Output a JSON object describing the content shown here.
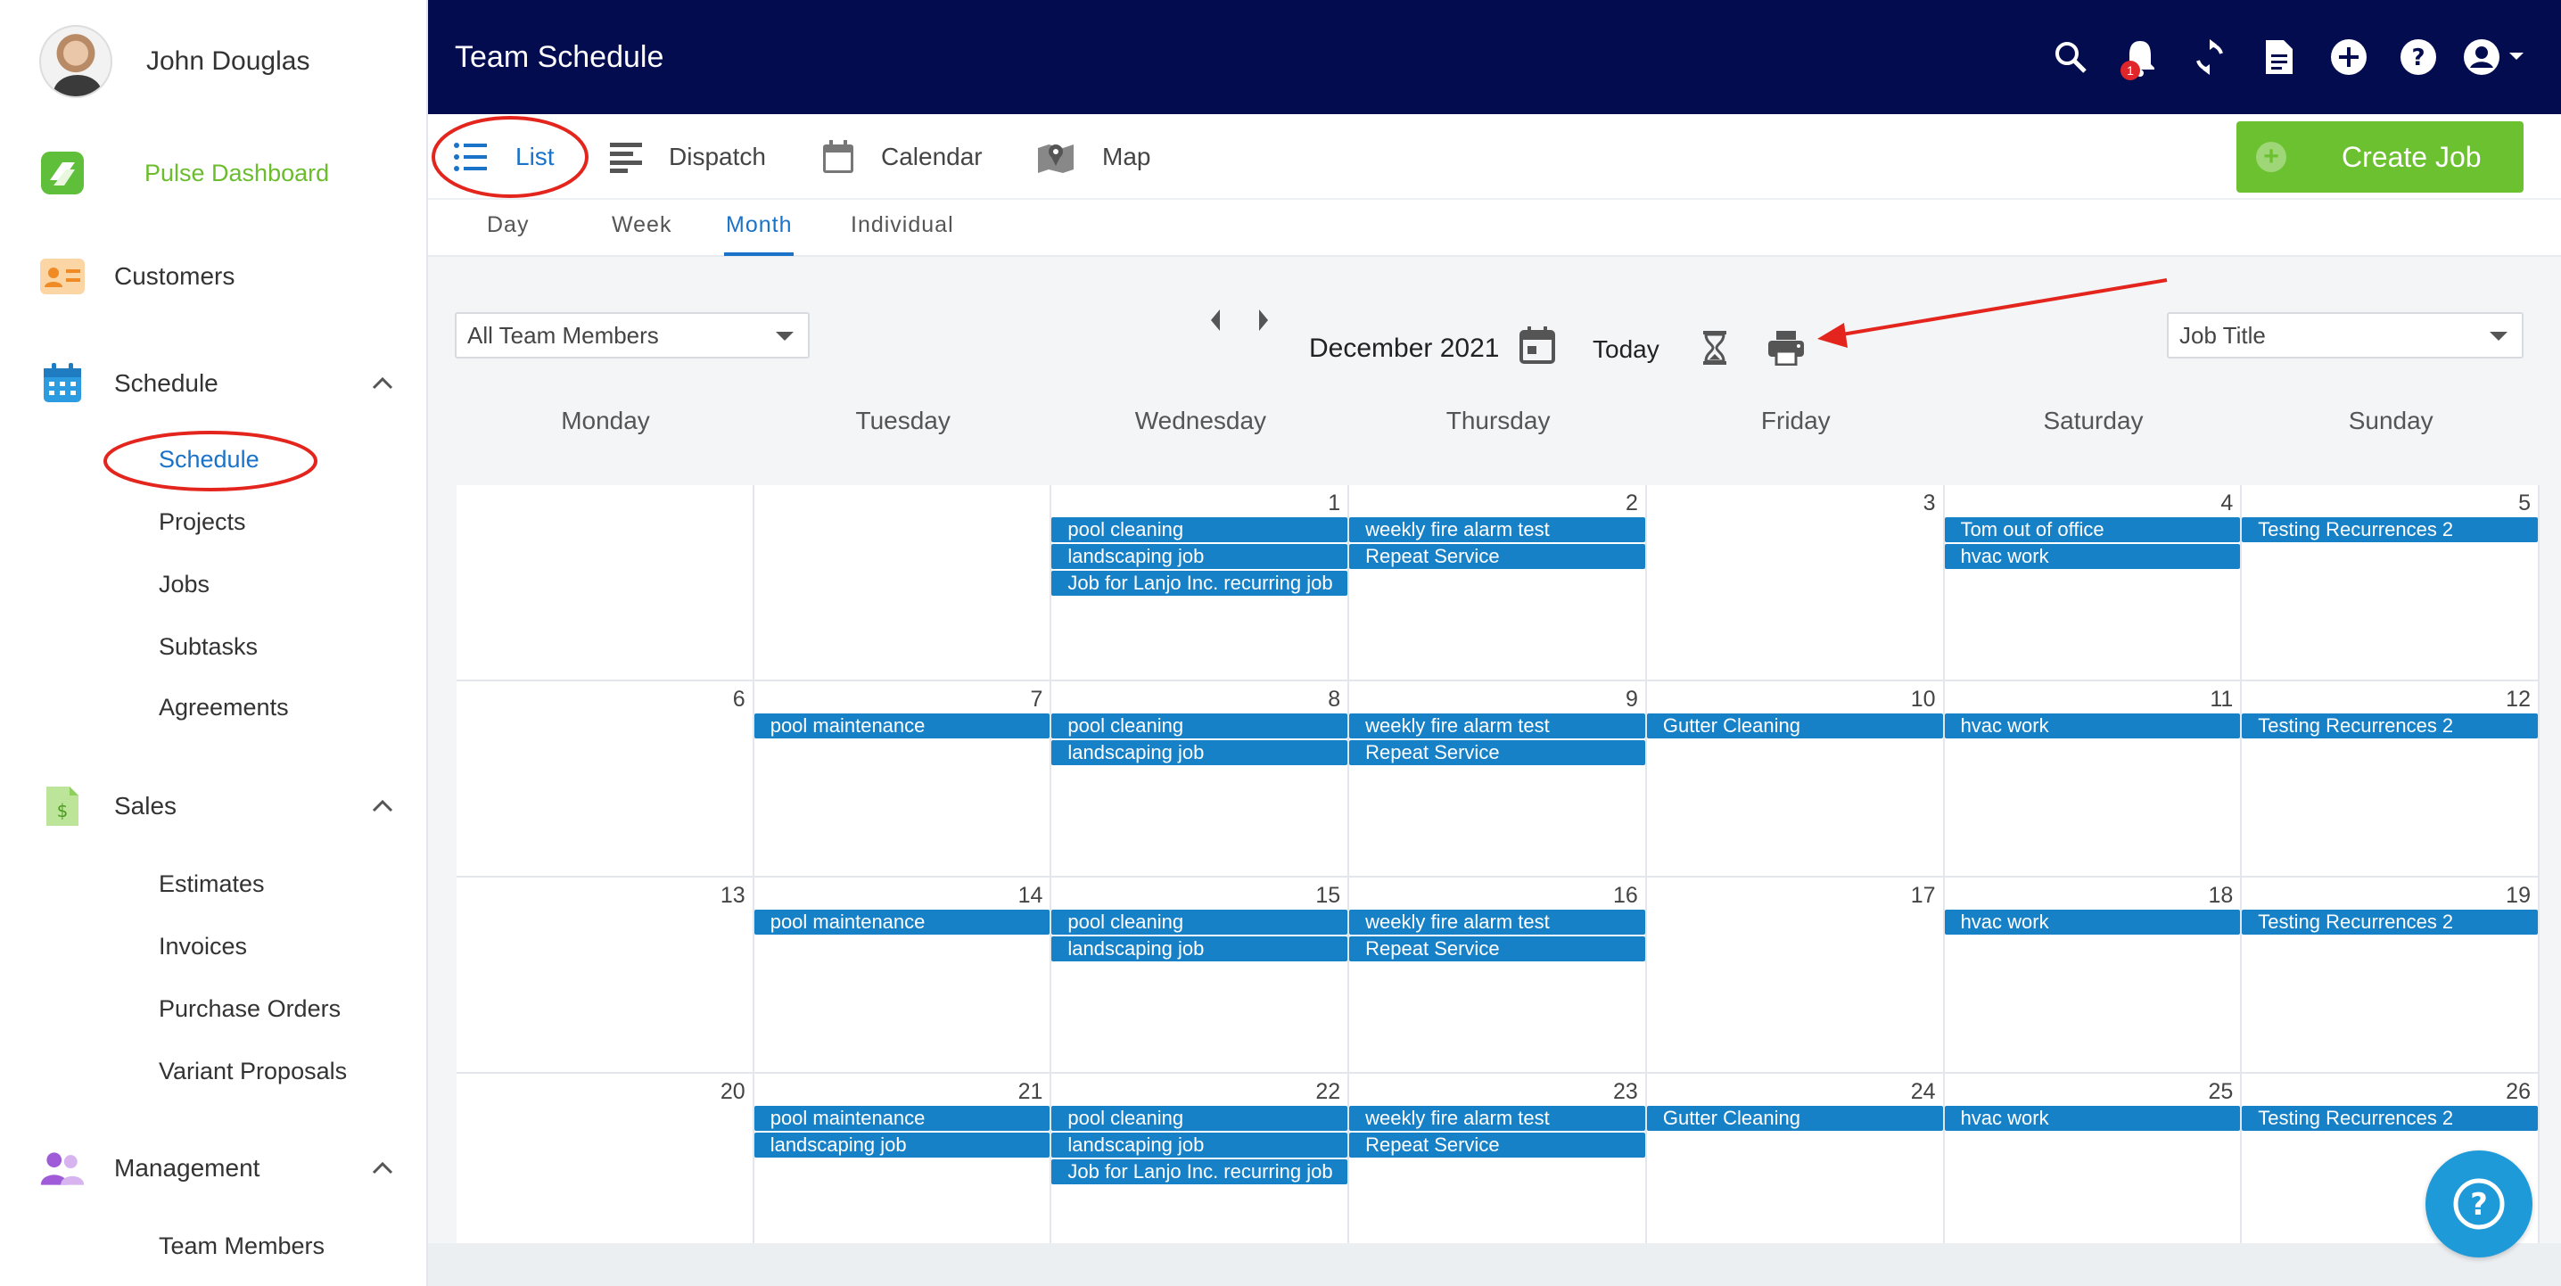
{
  "user": {
    "name": "John Douglas"
  },
  "sidebar": {
    "dashboard_label": "Pulse Dashboard",
    "customers_label": "Customers",
    "schedule_label": "Schedule",
    "schedule_items": [
      "Schedule",
      "Projects",
      "Jobs",
      "Subtasks",
      "Agreements"
    ],
    "sales_label": "Sales",
    "sales_items": [
      "Estimates",
      "Invoices",
      "Purchase Orders",
      "Variant Proposals"
    ],
    "management_label": "Management",
    "management_items": [
      "Team Members"
    ]
  },
  "header": {
    "title": "Team Schedule",
    "notification_count": "1"
  },
  "views": {
    "list": "List",
    "dispatch": "Dispatch",
    "calendar": "Calendar",
    "map": "Map",
    "create_job": "Create Job"
  },
  "subtabs": {
    "day": "Day",
    "week": "Week",
    "month": "Month",
    "individual": "Individual"
  },
  "toolbar": {
    "team_filter": "All Team Members",
    "month": "December 2021",
    "today": "Today",
    "sort_by": "Job Title"
  },
  "weekdays": [
    "Monday",
    "Tuesday",
    "Wednesday",
    "Thursday",
    "Friday",
    "Saturday",
    "Sunday"
  ],
  "weeks": [
    [
      {
        "day": "",
        "events": []
      },
      {
        "day": "",
        "events": []
      },
      {
        "day": "1",
        "events": [
          "pool cleaning",
          "landscaping job",
          "Job for Lanjo Inc. recurring job"
        ]
      },
      {
        "day": "2",
        "events": [
          "weekly fire alarm test",
          "Repeat Service"
        ]
      },
      {
        "day": "3",
        "events": []
      },
      {
        "day": "4",
        "events": [
          "Tom out of office",
          "hvac work"
        ]
      },
      {
        "day": "5",
        "events": [
          "Testing Recurrences 2"
        ]
      }
    ],
    [
      {
        "day": "6",
        "events": []
      },
      {
        "day": "7",
        "events": [
          "pool maintenance"
        ]
      },
      {
        "day": "8",
        "events": [
          "pool cleaning",
          "landscaping job"
        ]
      },
      {
        "day": "9",
        "events": [
          "weekly fire alarm test",
          "Repeat Service"
        ]
      },
      {
        "day": "10",
        "events": [
          "Gutter Cleaning"
        ]
      },
      {
        "day": "11",
        "events": [
          "hvac work"
        ]
      },
      {
        "day": "12",
        "events": [
          "Testing Recurrences 2"
        ]
      }
    ],
    [
      {
        "day": "13",
        "events": []
      },
      {
        "day": "14",
        "events": [
          "pool maintenance"
        ]
      },
      {
        "day": "15",
        "events": [
          "pool cleaning",
          "landscaping job"
        ]
      },
      {
        "day": "16",
        "events": [
          "weekly fire alarm test",
          "Repeat Service"
        ]
      },
      {
        "day": "17",
        "events": []
      },
      {
        "day": "18",
        "events": [
          "hvac work"
        ]
      },
      {
        "day": "19",
        "events": [
          "Testing Recurrences 2"
        ]
      }
    ],
    [
      {
        "day": "20",
        "events": []
      },
      {
        "day": "21",
        "events": [
          "pool maintenance",
          "landscaping job"
        ]
      },
      {
        "day": "22",
        "events": [
          "pool cleaning",
          "landscaping job",
          "Job for Lanjo Inc. recurring job"
        ]
      },
      {
        "day": "23",
        "events": [
          "weekly fire alarm test",
          "Repeat Service"
        ]
      },
      {
        "day": "24",
        "events": [
          "Gutter Cleaning"
        ]
      },
      {
        "day": "25",
        "events": [
          "hvac work"
        ]
      },
      {
        "day": "26",
        "events": [
          "Testing Recurrences 2"
        ]
      }
    ]
  ],
  "colors": {
    "header_bg": "#040c50",
    "accent_blue": "#1a73c8",
    "event_blue": "#1781c8",
    "create_green": "#6cc130",
    "annotation_red": "#e3251d"
  }
}
